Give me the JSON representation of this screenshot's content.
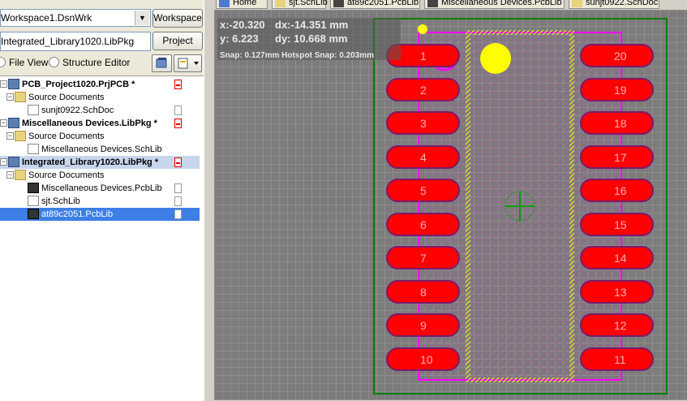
{
  "panel": {
    "workspace_combo": "Workspace1.DsnWrk",
    "workspace_button": "Workspace",
    "project_field": "Integrated_Library1020.LibPkg",
    "project_button": "Project",
    "view_file": "File View",
    "view_structure": "Structure Editor",
    "tree": [
      {
        "label": "PCB_Project1020.PrjPCB *",
        "bold": true,
        "icon": "pcb-project-icon",
        "status": "red",
        "expander": "-",
        "level": 0
      },
      {
        "label": "Source Documents",
        "bold": false,
        "icon": "folder-icon",
        "status": "",
        "expander": "-",
        "level": 1
      },
      {
        "label": "sunjt0922.SchDoc",
        "bold": false,
        "icon": "schematic-doc-icon",
        "status": "grey",
        "expander": "",
        "level": 2
      },
      {
        "label": "Miscellaneous Devices.LibPkg *",
        "bold": true,
        "icon": "library-package-icon",
        "status": "red",
        "expander": "-",
        "level": 0
      },
      {
        "label": "Source Documents",
        "bold": false,
        "icon": "folder-icon",
        "status": "",
        "expander": "-",
        "level": 1
      },
      {
        "label": "Miscellaneous Devices.SchLib",
        "bold": false,
        "icon": "schlib-icon",
        "status": "",
        "expander": "",
        "level": 2
      },
      {
        "label": "Integrated_Library1020.LibPkg *",
        "bold": true,
        "icon": "library-package-icon",
        "status": "red",
        "expander": "-",
        "level": 0,
        "selected": "light"
      },
      {
        "label": "Source Documents",
        "bold": false,
        "icon": "folder-icon",
        "status": "",
        "expander": "-",
        "level": 1
      },
      {
        "label": "Miscellaneous Devices.PcbLib",
        "bold": false,
        "icon": "pcblib-icon",
        "status": "grey",
        "expander": "",
        "level": 2
      },
      {
        "label": "sjt.SchLib",
        "bold": false,
        "icon": "schlib-icon",
        "status": "grey",
        "expander": "",
        "level": 2
      },
      {
        "label": "at89c2051.PcbLib",
        "bold": false,
        "icon": "pcblib-icon",
        "status": "grey",
        "expander": "",
        "level": 2,
        "selected": "dark"
      }
    ]
  },
  "tabs": [
    {
      "label": "Home",
      "icon": "home-icon"
    },
    {
      "label": "sjt.SchLib",
      "icon": "schlib-icon"
    },
    {
      "label": "at89c2051.PcbLib",
      "icon": "pcblib-icon"
    },
    {
      "label": "Miscellaneous Devices.PcbLib",
      "icon": "pcblib-icon"
    },
    {
      "label": "sunjt0922.SchDoc",
      "icon": "schematic-doc-icon"
    }
  ],
  "hud": {
    "x": "x:-20.320",
    "dx": "dx:-14.351 mm",
    "y": "y:  6.223",
    "dy": "dy: 10.668 mm",
    "snap": "Snap: 0.127mm Hotspot Snap: 0.203mm"
  },
  "pads_left": [
    "1",
    "2",
    "3",
    "4",
    "5",
    "6",
    "7",
    "8",
    "9",
    "10"
  ],
  "pads_right": [
    "20",
    "19",
    "18",
    "17",
    "16",
    "15",
    "14",
    "13",
    "12",
    "11"
  ],
  "colors": {
    "pad": "#ff0000",
    "overlay": "#ffff00",
    "courtyard": "#ff00ff",
    "board_outline": "#008000",
    "canvas": "#7d7b7b"
  }
}
